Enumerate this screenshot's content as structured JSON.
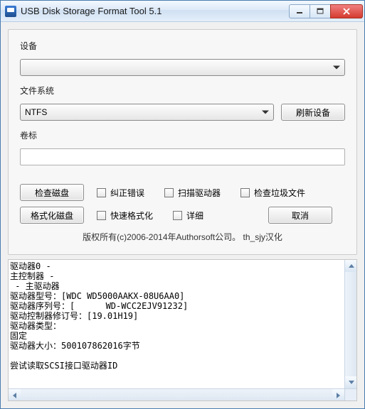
{
  "window": {
    "title": "USB Disk Storage Format Tool 5.1"
  },
  "labels": {
    "device": "设备",
    "filesystem": "文件系统",
    "volume_label": "卷标"
  },
  "fields": {
    "device_value": "",
    "filesystem_value": "NTFS",
    "volume_label_value": ""
  },
  "buttons": {
    "refresh": "刷新设备",
    "check_disk": "检查磁盘",
    "format_disk": "格式化磁盘",
    "cancel": "取消"
  },
  "checks": {
    "correct_errors": "纠正错误",
    "scan_drive": "扫描驱动器",
    "check_junk": "检查垃圾文件",
    "quick_format": "快速格式化",
    "verbose": "详细"
  },
  "copyright": "版权所有(c)2006-2014年Authorsoft公司。  th_sjy汉化",
  "log": "驱动器0 -\n主控制器 -\n - 主驱动器\n驱动器型号：[WDC WD5000AAKX-08U6AA0]\n驱动器序列号：[      WD-WCC2EJV91232]\n驱动控制器修订号：[19.01H19]\n驱动器类型：\n固定\n驱动器大小：500107862016字节\n\n尝试读取SCSI接口驱动器ID"
}
